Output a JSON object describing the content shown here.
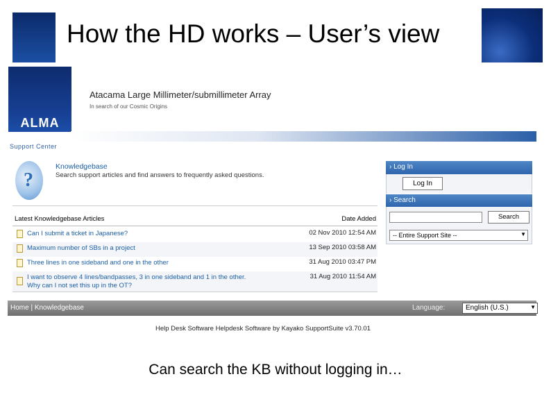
{
  "slide": {
    "title": "How the HD works – User’s view",
    "caption": "Can search the KB without logging in…"
  },
  "site": {
    "logo_text": "ALMA",
    "title": "Atacama Large Millimeter/submillimeter Array",
    "subtitle": "In search of our Cosmic Origins",
    "section": "Support Center"
  },
  "kb": {
    "title": "Knowledgebase",
    "description": "Search support articles and find answers to frequently asked questions.",
    "table_header_left": "Latest Knowledgebase Articles",
    "table_header_right": "Date Added",
    "rows": [
      {
        "title": "Can I submit a ticket in Japanese?",
        "date": "02 Nov 2010 12:54 AM"
      },
      {
        "title": "Maximum number of SBs in a project",
        "date": "13 Sep 2010 03:58 AM"
      },
      {
        "title": "Three lines in one sideband and one in the other",
        "date": "31 Aug 2010 03:47 PM"
      },
      {
        "title": "I want to observe 4 lines/bandpasses, 3 in one sideband and 1 in the other. Why can I not set this up in the OT?",
        "date": "31 Aug 2010 11:54 AM"
      }
    ]
  },
  "sidebar": {
    "login_header": "Log In",
    "login_button": "Log In",
    "search_header": "Search",
    "search_button": "Search",
    "search_value": "",
    "scope_selected": "-- Entire Support Site --"
  },
  "footer": {
    "breadcrumb": "Home | Knowledgebase",
    "language_label": "Language:",
    "language_selected": "English (U.S.)",
    "powered_by": "Help Desk Software Helpdesk Software by Kayako SupportSuite v3.70.01"
  },
  "icons": {
    "doc": "document-icon",
    "kb": "help-question-icon",
    "arrow": "chevron-right-icon",
    "dropdown": "dropdown-arrow-icon"
  },
  "colors": {
    "link": "#1b5ea6",
    "header_blue": "#2f66ad",
    "footer_gray": "#6f6f6f"
  }
}
